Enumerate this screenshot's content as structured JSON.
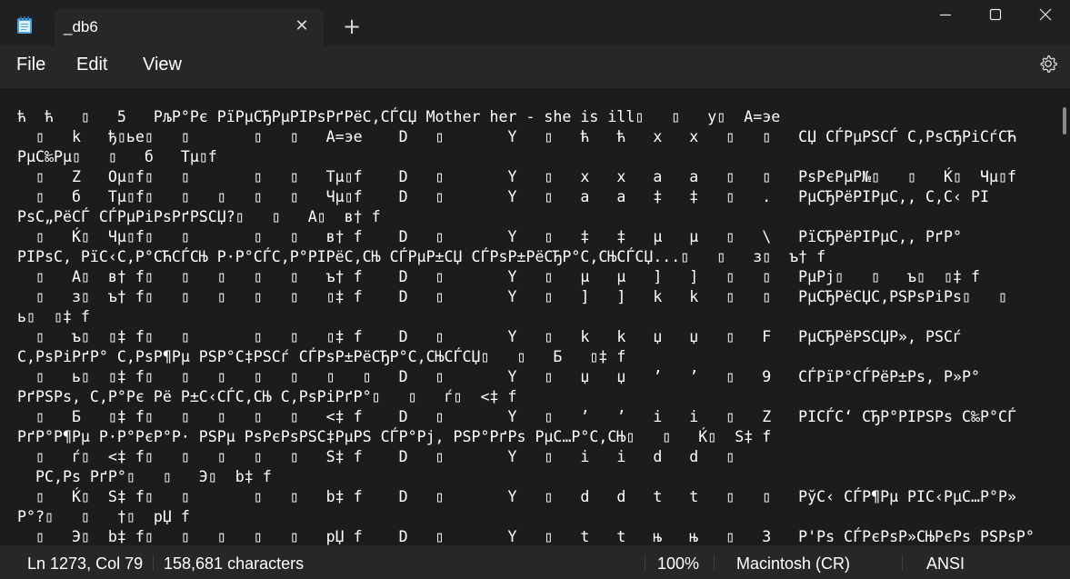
{
  "window": {
    "tab_title": "_db6",
    "tab_close_glyph": "✕",
    "new_tab_glyph": "+",
    "app_icon": "notepad-icon"
  },
  "menu": {
    "file": "File",
    "edit": "Edit",
    "view": "View",
    "settings_icon": "gear-icon"
  },
  "editor": {
    "lines": [
      "ћ  ћ   ▯   5   РљР°Рє РїРµСЂРµРІРѕРґРёС‚СЃСЏ Mother her - she is ill▯   ▯   y▯  A=эе",
      "  ▯   k   ђ▯ье▯   ▯       ▯   ▯   A=эе    D   ▯       Y   ▯   ћ   ћ   x   x   ▯   ▯   СЏ СЃРµРЅСЃ С‚РѕСЂРіСѓСЋ",
      "РµС‰Рµ▯   ▯   б   Тµ▯f",
      "  ▯   Z   Oµ▯f▯   ▯       ▯   ▯   Тµ▯f    D   ▯       Y   ▯   x   x   a   a   ▯   ▯   РѕРєРµР№▯   ▯   Ќ▯  Чµ▯f",
      "  ▯   б   Тµ▯f▯   ▯   ▯   ▯   ▯   Чµ▯f    D   ▯       Y   ▯   a   a   ‡   ‡   ▯   .   РµСЂРёРІРµС‚, С‚С‹ РІ",
      "РѕС„РёСЃ СЃРµРіРѕРґРЅСЏ?▯   ▯   A▯  в† f",
      "  ▯   Ќ▯  Чµ▯f▯   ▯       ▯   ▯   в† f    D   ▯       Y   ▯   ‡   ‡   µ   µ   ▯   \\   РїСЂРёРІРµС‚, РґР°",
      "РІРѕС‚ РїС‹С‚Р°СЋСЃСЊ Р·Р°СЃС‚Р°РІРёС‚СЊ СЃРµР±СЏ СЃРѕР±РёСЂР°С‚СЊСЃСЏ...▯   ▯   з▯  ъ† f",
      "  ▯   A▯  в† f▯   ▯   ▯   ▯   ▯   ъ† f    D   ▯       Y   ▯   µ   µ   ]   ]   ▯   ▯   РµРј▯   ▯   ъ▯  ▯‡ f",
      "  ▯   з▯  ъ† f▯   ▯   ▯   ▯   ▯   ▯‡ f    D   ▯       Y   ▯   ]   ]   k   k   ▯   ▯   РµСЂРёСЏС‚РЅРѕРіРѕ▯   ▯",
      "ь▯  ▯‡ f",
      "  ▯   ъ▯  ▯‡ f▯   ▯       ▯   ▯   ▯‡ f    D   ▯       Y   ▯   k   k   џ   џ   ▯   F   РµСЂРёРЅСЏР», РЅСѓ",
      "С‚РѕРіРґР° С‚РѕР¶Рµ РЅР°С‡РЅСѓ СЃРѕР±РёСЂР°С‚СЊСЃСЏ▯   ▯   Б   ▯‡ f",
      "  ▯   ь▯  ▯‡ f▯   ▯   ▯   ▯   ▯   ▯   ▯   D   ▯       Y   ▯   џ   џ   ’   ’   ▯   9   СЃРїР°СЃРёР±Рѕ, Р»Р°",
      "РґРЅРѕ, С‚Р°Рє Рё Р±С‹СЃС‚СЊ С‚РѕРіРґР°▯   ▯   ѓ▯  <‡ f",
      "  ▯   Б   ▯‡ f▯   ▯   ▯   ▯   ▯   <‡ f    D   ▯       Y   ▯   ’   ’   i   i   ▯   Z   РІСЃС‘ СЂР°РІРЅРѕ С‰Р°СЃ",
      "РґР°Р¶Рµ Р·Р°РєР°Р· РЅРµ РѕРєРѕРЅС‡РµРЅ СЃР°Рј, РЅР°РґРѕ РµС…Р°С‚СЊ▯   ▯   Ќ▯  S‡ f",
      "  ▯   ѓ▯  <‡ f▯   ▯   ▯   ▯   ▯   S‡ f    D   ▯       Y   ▯   i   i   d   d   ▯",
      "  РС‚Рѕ РґР°▯   ▯   Э▯  b‡ f",
      "  ▯   Ќ▯  S‡ f▯   ▯       ▯   ▯   b‡ f    D   ▯       Y   ▯   d   d   t   t   ▯   ▯   РўС‹ СЃР¶Рµ РІС‹РµС…Р°Р»",
      "Р°?▯   ▯   †▯  pЏ f",
      "  ▯   Э▯  b‡ f▯   ▯   ▯   ▯   ▯   pЏ f    D   ▯       Y   ▯   t   t   њ   њ   ▯   3   Р'Рѕ СЃРєРѕР»СЊРєРѕ РЅРѕР°"
    ]
  },
  "status": {
    "position": "Ln 1273, Col 79",
    "characters": "158,681 characters",
    "zoom": "100%",
    "line_ending": "Macintosh (CR)",
    "encoding": "ANSI"
  }
}
